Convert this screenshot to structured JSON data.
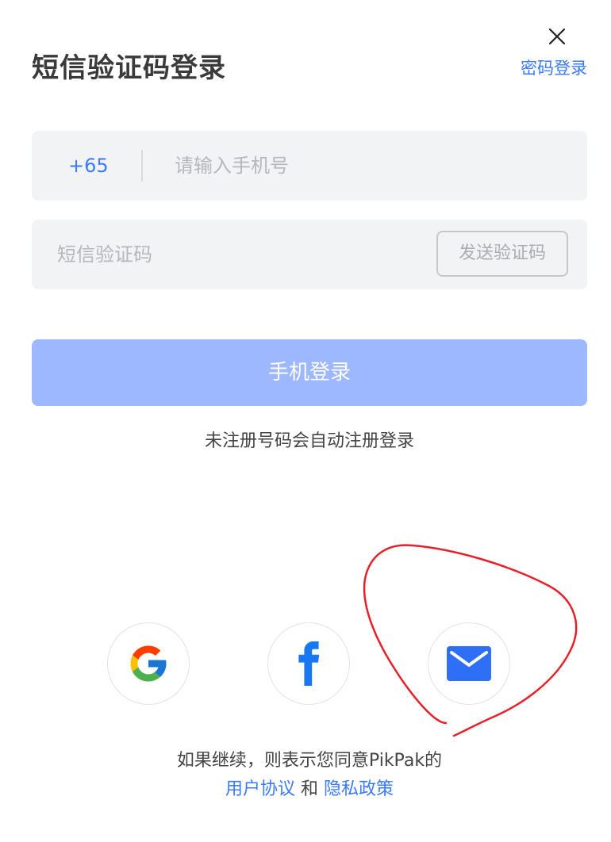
{
  "header": {
    "title": "短信验证码登录",
    "switch_link": "密码登录",
    "close_icon": "close-icon"
  },
  "phone": {
    "country_code": "+65",
    "placeholder": "请输入手机号"
  },
  "code": {
    "placeholder": "短信验证码",
    "send_label": "发送验证码"
  },
  "submit": {
    "label": "手机登录"
  },
  "hint": "未注册号码会自动注册登录",
  "social": [
    {
      "name": "Google",
      "icon": "google-icon"
    },
    {
      "name": "Facebook",
      "icon": "facebook-icon"
    },
    {
      "name": "Email",
      "icon": "mail-icon"
    }
  ],
  "agreement": {
    "text": "如果继续，则表示您同意PikPak的",
    "terms_link": "用户协议",
    "conjunction": "和",
    "privacy_link": "隐私政策"
  },
  "colors": {
    "accent": "#3a7afe",
    "button_disabled": "#9db8ff",
    "field_bg": "#f2f3f5",
    "annotation": "#e8202a"
  }
}
